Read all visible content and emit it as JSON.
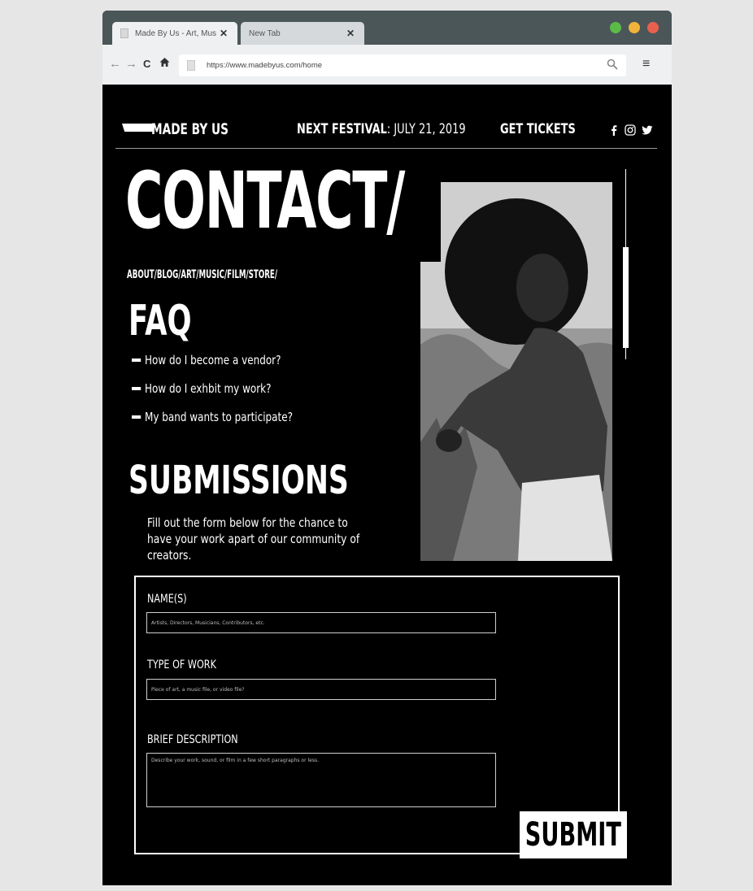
{
  "browser": {
    "tabs": [
      {
        "label": "Made By Us - Art, Music",
        "close": "✕"
      },
      {
        "label": "New Tab",
        "close": "✕"
      }
    ],
    "url": "https://www.madebyus.com/home",
    "nav": {
      "back": "←",
      "forward": "→",
      "reload": "C",
      "home": "⌂",
      "menu": "≡"
    }
  },
  "header": {
    "logo": "MADE BY US",
    "festival_label": "NEXT FESTIVAL",
    "festival_date": ": JULY 21, 2019",
    "tickets": "GET TICKETS"
  },
  "hero": {
    "title": "CONTACT/",
    "crumbs": "ABOUT/BLOG/ART/MUSIC/FILM/STORE/"
  },
  "faq": {
    "title": "FAQ",
    "items": [
      "How do I become a vendor?",
      "How do I exhbit my work?",
      "My band wants to participate?"
    ]
  },
  "submissions": {
    "title": "SUBMISSIONS",
    "text": "Fill out the form below for the chance to have your work apart of our community of creators."
  },
  "form": {
    "name_label": "NAME(S)",
    "name_placeholder": "Artists, Directors, Musicians, Contributors, etc.",
    "type_label": "TYPE OF WORK",
    "type_placeholder": "Piece of art, a music file, or video file?",
    "desc_label": "BRIEF DESCRIPTION",
    "desc_placeholder": "Describe your work, sound, or film in a few short paragraphs or less.",
    "submit": "SUBMIT"
  }
}
